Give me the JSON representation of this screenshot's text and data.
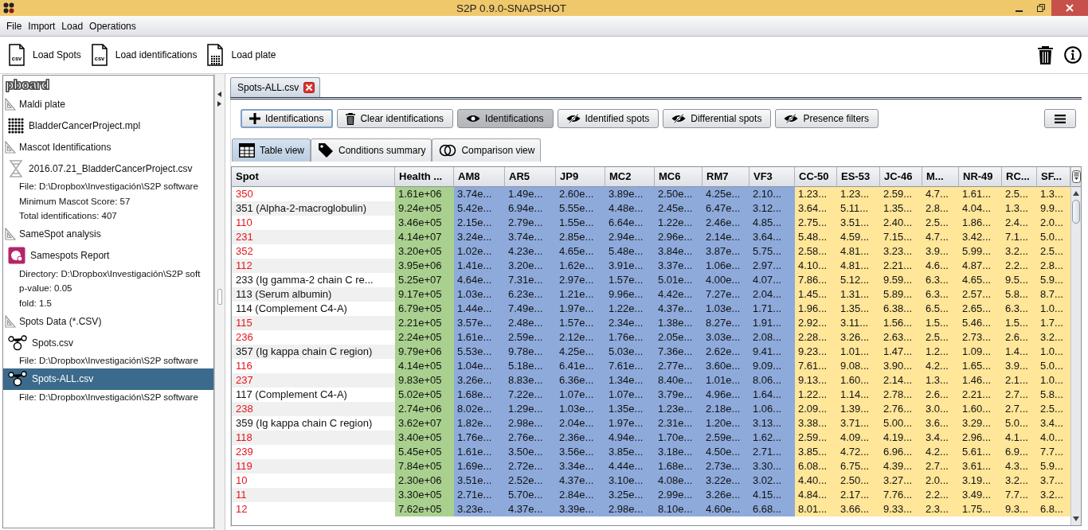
{
  "window": {
    "title": "S2P 0.9.0-SNAPSHOT"
  },
  "menu": [
    "File",
    "Import",
    "Load",
    "Operations"
  ],
  "toolbar": [
    {
      "label": "Load Spots",
      "kind": "csv",
      "icon_text": "csv"
    },
    {
      "label": "Load identifications",
      "kind": "csv",
      "icon_text": "csv"
    },
    {
      "label": "Load plate",
      "kind": "plate"
    }
  ],
  "sidebar": {
    "title": "pboard",
    "groups": [
      {
        "label": "Maldi plate",
        "children": [
          {
            "label": "BladderCancerProject.mpl",
            "kind": "plate",
            "selected": false
          }
        ]
      },
      {
        "label": "Mascot Identifications",
        "children": [
          {
            "label": "2016.07.21_BladderCancerProject.csv",
            "kind": "mascot",
            "selected": false,
            "details": [
              "File: D:\\Dropbox\\Investigación\\S2P software",
              "Minimum Mascot Score: 57",
              "Total identifications: 407"
            ]
          }
        ]
      },
      {
        "label": "SameSpot analysis",
        "children": [
          {
            "label": "Samespots Report",
            "kind": "samespots",
            "selected": false,
            "details": [
              "Directory: D:\\Dropbox\\Investigación\\S2P soft",
              "p-value: 0.05",
              "fold: 1.5"
            ]
          }
        ]
      },
      {
        "label": "Spots Data (*.CSV)",
        "children": [
          {
            "label": "Spots.csv",
            "kind": "spots",
            "selected": false,
            "details": [
              "File: D:\\Dropbox\\Investigación\\S2P software"
            ]
          },
          {
            "label": "Spots-ALL.csv",
            "kind": "spots",
            "selected": true,
            "details": [
              "File: D:\\Dropbox\\Investigación\\S2P software"
            ]
          }
        ]
      }
    ]
  },
  "document_tab": {
    "label": "Spots-ALL.csv"
  },
  "actions": [
    {
      "label": "Identifications",
      "kind": "add"
    },
    {
      "label": "Clear identifications",
      "kind": "clear"
    },
    {
      "label": "Identifications",
      "kind": "toggle",
      "on": true
    },
    {
      "label": "Identified spots",
      "kind": "toggle",
      "on": false
    },
    {
      "label": "Differential spots",
      "kind": "toggle",
      "on": false
    },
    {
      "label": "Presence filters",
      "kind": "toggle",
      "on": false
    }
  ],
  "view_tabs": [
    {
      "label": "Table view",
      "kind": "table",
      "selected": true
    },
    {
      "label": "Conditions summary",
      "kind": "tag",
      "selected": false
    },
    {
      "label": "Comparison view",
      "kind": "compare",
      "selected": false
    }
  ],
  "table": {
    "columns": [
      {
        "label": "Spot"
      },
      {
        "label": "Health ...",
        "color": "#a9d08e"
      },
      {
        "label": "AM8",
        "color": "#8eaadb"
      },
      {
        "label": "AR5",
        "color": "#8eaadb"
      },
      {
        "label": "JP9",
        "color": "#8eaadb"
      },
      {
        "label": "MC2",
        "color": "#8eaadb"
      },
      {
        "label": "MC6",
        "color": "#8eaadb"
      },
      {
        "label": "RM7",
        "color": "#8eaadb"
      },
      {
        "label": "VF3",
        "color": "#8eaadb"
      },
      {
        "label": "CC-50",
        "color": "#ffe699"
      },
      {
        "label": "ES-53",
        "color": "#ffe699"
      },
      {
        "label": "JC-46",
        "color": "#ffe699"
      },
      {
        "label": "M...",
        "color": "#ffe699"
      },
      {
        "label": "NR-49",
        "color": "#ffe699"
      },
      {
        "label": "RC...",
        "color": "#ffe699"
      },
      {
        "label": "SF...",
        "color": "#ffe699"
      }
    ],
    "rows": [
      {
        "spot": "350",
        "identified": false,
        "values": [
          "1.61e+06",
          "3.74e...",
          "1.49e...",
          "2.60e...",
          "3.89e...",
          "2.50e...",
          "4.25e...",
          "2.10...",
          "1.23...",
          "1.23...",
          "2.59...",
          "4.7...",
          "1.61...",
          "2.5...",
          "1.3..."
        ]
      },
      {
        "spot": "351 (Alpha-2-macroglobulin)",
        "identified": true,
        "values": [
          "9.24e+05",
          "5.42e...",
          "6.94e...",
          "5.55e...",
          "4.48e...",
          "2.45e...",
          "6.47e...",
          "3.12...",
          "3.64...",
          "5.11...",
          "1.35...",
          "2.8...",
          "4.04...",
          "1.3...",
          "9.9..."
        ]
      },
      {
        "spot": "110",
        "identified": false,
        "values": [
          "3.46e+05",
          "2.15e...",
          "2.79e...",
          "1.55e...",
          "6.64e...",
          "1.22e...",
          "2.46e...",
          "4.85...",
          "2.75...",
          "3.51...",
          "2.40...",
          "2.5...",
          "1.86...",
          "2.4...",
          "2.0..."
        ]
      },
      {
        "spot": "231",
        "identified": false,
        "values": [
          "4.14e+07",
          "3.24e...",
          "3.74e...",
          "2.85e...",
          "2.94e...",
          "2.96e...",
          "2.14e...",
          "3.64...",
          "5.48...",
          "4.59...",
          "7.15...",
          "4.7...",
          "3.42...",
          "7.1...",
          "5.0..."
        ]
      },
      {
        "spot": "352",
        "identified": false,
        "values": [
          "3.20e+05",
          "1.02e...",
          "4.23e...",
          "4.65e...",
          "5.48e...",
          "3.84e...",
          "3.87e...",
          "5.75...",
          "2.58...",
          "4.81...",
          "3.23...",
          "3.9...",
          "5.99...",
          "3.2...",
          "2.5..."
        ]
      },
      {
        "spot": "112",
        "identified": false,
        "values": [
          "3.95e+06",
          "1.41e...",
          "3.20e...",
          "1.62e...",
          "3.91e...",
          "3.37e...",
          "1.06e...",
          "2.97...",
          "4.10...",
          "4.81...",
          "2.21...",
          "4.6...",
          "4.87...",
          "2.2...",
          "2.8..."
        ]
      },
      {
        "spot": "233 (Ig gamma-2 chain C re...",
        "identified": true,
        "values": [
          "5.25e+07",
          "4.64e...",
          "7.31e...",
          "2.97e...",
          "1.57e...",
          "5.01e...",
          "4.00e...",
          "4.07...",
          "7.86...",
          "5.12...",
          "9.59...",
          "6.3...",
          "4.65...",
          "9.5...",
          "5.9..."
        ]
      },
      {
        "spot": "113 (Serum albumin)",
        "identified": true,
        "values": [
          "9.17e+05",
          "1.03e...",
          "6.23e...",
          "1.21e...",
          "9.96e...",
          "4.42e...",
          "7.27e...",
          "2.04...",
          "1.45...",
          "1.31...",
          "5.89...",
          "6.3...",
          "2.57...",
          "5.8...",
          "8.7..."
        ]
      },
      {
        "spot": "114 (Complement C4-A)",
        "identified": true,
        "values": [
          "6.79e+05",
          "1.44e...",
          "7.49e...",
          "1.97e...",
          "1.22e...",
          "4.37e...",
          "1.03e...",
          "1.71...",
          "1.96...",
          "1.35...",
          "6.38...",
          "6.5...",
          "2.65...",
          "6.3...",
          "1.0..."
        ]
      },
      {
        "spot": "115",
        "identified": false,
        "values": [
          "2.21e+05",
          "3.57e...",
          "2.48e...",
          "1.57e...",
          "2.34e...",
          "1.38e...",
          "8.27e...",
          "1.91...",
          "2.92...",
          "3.11...",
          "1.56...",
          "1.5...",
          "5.46...",
          "1.5...",
          "1.7..."
        ]
      },
      {
        "spot": "236",
        "identified": false,
        "values": [
          "2.24e+05",
          "1.61e...",
          "2.59e...",
          "2.12e...",
          "1.76e...",
          "2.05e...",
          "3.03e...",
          "2.08...",
          "2.28...",
          "3.26...",
          "2.63...",
          "2.5...",
          "2.73...",
          "2.6...",
          "3.2..."
        ]
      },
      {
        "spot": "357 (Ig kappa chain C region)",
        "identified": true,
        "values": [
          "9.79e+06",
          "5.53e...",
          "9.78e...",
          "4.25e...",
          "5.03e...",
          "7.36e...",
          "2.62e...",
          "9.41...",
          "9.23...",
          "1.01...",
          "1.47...",
          "1.2...",
          "1.09...",
          "1.4...",
          "1.0..."
        ]
      },
      {
        "spot": "116",
        "identified": false,
        "values": [
          "4.14e+05",
          "1.04e...",
          "5.18e...",
          "6.41e...",
          "7.61e...",
          "2.77e...",
          "3.60e...",
          "9.09...",
          "7.61...",
          "9.08...",
          "3.90...",
          "4.2...",
          "1.65...",
          "3.9...",
          "5.0..."
        ]
      },
      {
        "spot": "237",
        "identified": false,
        "values": [
          "9.83e+05",
          "3.26e...",
          "8.83e...",
          "6.36e...",
          "1.34e...",
          "8.40e...",
          "1.01e...",
          "8.06...",
          "9.13...",
          "1.60...",
          "2.14...",
          "1.3...",
          "1.46...",
          "2.1...",
          "1.0..."
        ]
      },
      {
        "spot": "117 (Complement C4-A)",
        "identified": true,
        "values": [
          "5.02e+05",
          "1.68e...",
          "7.22e...",
          "1.07e...",
          "1.07e...",
          "3.79e...",
          "4.96e...",
          "1.64...",
          "1.22...",
          "1.14...",
          "2.78...",
          "2.6...",
          "2.21...",
          "2.7...",
          "5.8..."
        ]
      },
      {
        "spot": "238",
        "identified": false,
        "values": [
          "2.74e+06",
          "8.02e...",
          "1.29e...",
          "1.03e...",
          "1.35e...",
          "1.23e...",
          "2.18e...",
          "1.06...",
          "2.09...",
          "1.39...",
          "2.76...",
          "3.0...",
          "1.60...",
          "2.7...",
          "2.5..."
        ]
      },
      {
        "spot": "359 (Ig kappa chain C region)",
        "identified": true,
        "values": [
          "3.62e+07",
          "1.82e...",
          "2.98e...",
          "2.04e...",
          "1.97e...",
          "2.31e...",
          "1.20e...",
          "3.13...",
          "3.38...",
          "3.71...",
          "5.00...",
          "3.6...",
          "3.29...",
          "5.0...",
          "3.4..."
        ]
      },
      {
        "spot": "118",
        "identified": false,
        "values": [
          "3.40e+05",
          "1.76e...",
          "2.76e...",
          "2.36e...",
          "4.94e...",
          "1.70e...",
          "2.59e...",
          "1.62...",
          "2.59...",
          "4.09...",
          "4.19...",
          "3.4...",
          "2.96...",
          "4.1...",
          "4.0..."
        ]
      },
      {
        "spot": "239",
        "identified": false,
        "values": [
          "5.45e+05",
          "1.61e...",
          "3.50e...",
          "3.56e...",
          "3.85e...",
          "3.18e...",
          "4.50e...",
          "2.71...",
          "3.85...",
          "4.72...",
          "6.96...",
          "4.2...",
          "5.61...",
          "6.9...",
          "7.7..."
        ]
      },
      {
        "spot": "119",
        "identified": false,
        "values": [
          "7.84e+05",
          "1.69e...",
          "2.72e...",
          "3.34e...",
          "4.44e...",
          "1.68e...",
          "2.73e...",
          "3.30...",
          "6.08...",
          "6.75...",
          "4.39...",
          "2.7...",
          "3.61...",
          "4.3...",
          "5.9..."
        ]
      },
      {
        "spot": "10",
        "identified": false,
        "values": [
          "2.30e+06",
          "3.51e...",
          "2.52e...",
          "4.37e...",
          "3.10e...",
          "4.08e...",
          "3.22e...",
          "3.02...",
          "4.40...",
          "2.50...",
          "3.27...",
          "2.0...",
          "3.19...",
          "3.2...",
          "3.7..."
        ]
      },
      {
        "spot": "11",
        "identified": false,
        "values": [
          "3.30e+05",
          "2.71e...",
          "5.70e...",
          "2.84e...",
          "3.25e...",
          "2.99e...",
          "3.26e...",
          "4.15...",
          "4.84...",
          "2.17...",
          "7.76...",
          "2.2...",
          "3.49...",
          "7.7...",
          "3.2..."
        ]
      },
      {
        "spot": "12",
        "identified": false,
        "values": [
          "7.62e+05",
          "3.23e...",
          "4.37e...",
          "3.39e...",
          "2.98e...",
          "8.10e...",
          "4.60e...",
          "6.68...",
          "8.01...",
          "3.66...",
          "9.33...",
          "2.3...",
          "1.75...",
          "9.3...",
          "6.8..."
        ]
      }
    ]
  }
}
